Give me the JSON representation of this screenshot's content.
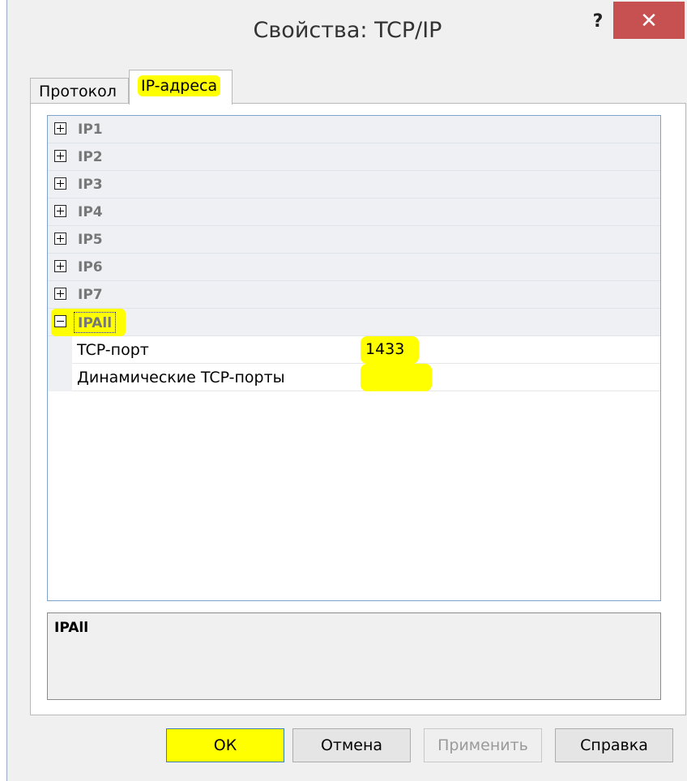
{
  "window": {
    "title": "Свойства: TCP/IP",
    "help_glyph": "?",
    "close_glyph": "✕"
  },
  "tabs": [
    {
      "label": "Протокол",
      "active": false
    },
    {
      "label": "IP-адреса",
      "active": true
    }
  ],
  "tree": {
    "collapsed_groups": [
      "IP1",
      "IP2",
      "IP3",
      "IP4",
      "IP5",
      "IP6",
      "IP7"
    ],
    "expanded_group": {
      "label": "IPAll",
      "properties": [
        {
          "name": "TCP-порт",
          "value": "1433"
        },
        {
          "name": "Динамические TCP-порты",
          "value": ""
        }
      ]
    }
  },
  "description": {
    "title": "IPAll"
  },
  "buttons": {
    "ok": "ОК",
    "cancel": "Отмена",
    "apply": "Применить",
    "help": "Справка"
  },
  "colors": {
    "highlight": "#ffff00",
    "close_button": "#c75050",
    "grid_border": "#7da2ce"
  }
}
